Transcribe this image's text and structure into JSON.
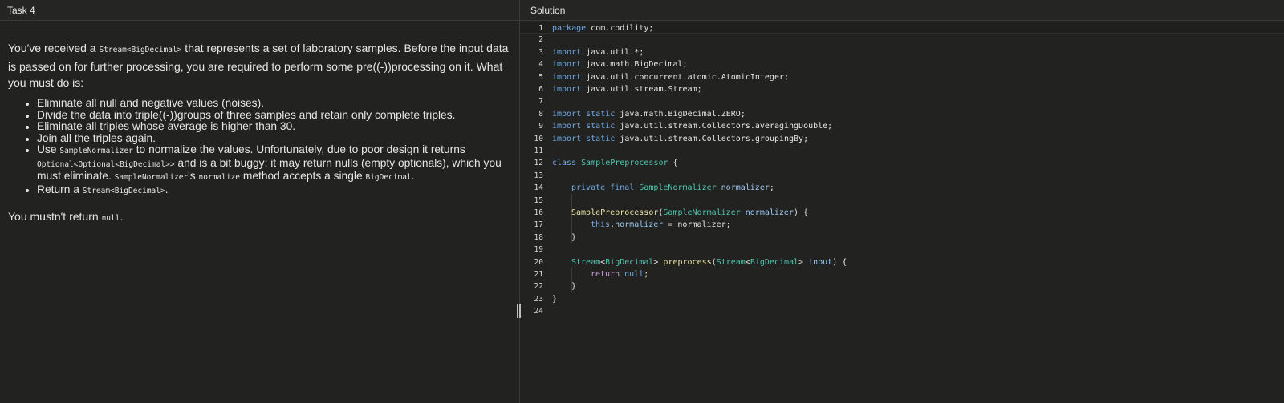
{
  "task": {
    "header": "Task 4",
    "intro_1": "You've received a ",
    "intro_code": "Stream<BigDecimal>",
    "intro_2": " that represents a set of laboratory samples. Before the input data is passed on for further processing, you are required to perform some pre((-))processing on it. What you must do is:",
    "items": {
      "i1": "Eliminate all null and negative values (noises).",
      "i2": "Divide the data into triple((-))groups of three samples and retain only complete triples.",
      "i3": "Eliminate all triples whose average is higher than 30.",
      "i4": "Join all the triples again.",
      "i5_a": "Use ",
      "i5_code1": "SampleNormalizer",
      "i5_b": " to normalize the values. Unfortunately, due to poor design it returns ",
      "i5_code2": "Optional<Optional<BigDecimal>>",
      "i5_c": " and is a bit buggy: it may return nulls (empty optionals), which you must eliminate. ",
      "i5_code3": "SampleNormalizer",
      "i5_d": "'s ",
      "i5_code4": "normalize",
      "i5_e": " method accepts a single ",
      "i5_code5": "BigDecimal",
      "i5_f": ".",
      "i6_a": "Return a ",
      "i6_code": "Stream<BigDecimal>",
      "i6_b": "."
    },
    "must_not_a": "You mustn't return ",
    "must_not_code": "null",
    "must_not_b": "."
  },
  "solution": {
    "header": "Solution",
    "line_numbers": [
      "1",
      "2",
      "3",
      "4",
      "5",
      "6",
      "7",
      "8",
      "9",
      "10",
      "11",
      "12",
      "13",
      "14",
      "15",
      "16",
      "17",
      "18",
      "19",
      "20",
      "21",
      "22",
      "23",
      "24"
    ],
    "code": {
      "l1_kw": "package",
      "l1_t": " com.codility;",
      "l3_kw": "import",
      "l3_t": " java.util.*;",
      "l4_kw": "import",
      "l4_t": " java.math.BigDecimal;",
      "l5_kw": "import",
      "l5_t": " java.util.concurrent.atomic.AtomicInteger;",
      "l6_kw": "import",
      "l6_t": " java.util.stream.Stream;",
      "l8_kw": "import static",
      "l8_t": " java.math.BigDecimal.ZERO;",
      "l9_kw": "import static",
      "l9_t": " java.util.stream.Collectors.averagingDouble;",
      "l10_kw": "import static",
      "l10_t": " java.util.stream.Collectors.groupingBy;",
      "l12_kw": "class",
      "l12_ty": " SamplePreprocessor",
      "l12_t": " {",
      "l14_kw": "private final",
      "l14_ty": " SampleNormalizer",
      "l14_fld": " normalizer",
      "l14_t": ";",
      "l16_fn": "SamplePreprocessor",
      "l16_a": "(",
      "l16_ty": "SampleNormalizer",
      "l16_fld": " normalizer",
      "l16_b": ") {",
      "l17_kw": "this",
      "l17_a": ".",
      "l17_fld": "normalizer",
      "l17_b": " = normalizer;",
      "l18_t": "}",
      "l20_ty1": "Stream",
      "l20_a": "<",
      "l20_ty2": "BigDecimal",
      "l20_b": "> ",
      "l20_fn": "preprocess",
      "l20_c": "(",
      "l20_ty3": "Stream",
      "l20_d": "<",
      "l20_ty4": "BigDecimal",
      "l20_e": ">",
      "l20_fld": " input",
      "l20_f": ") {",
      "l21_kw": "return",
      "l21_kw2": " null",
      "l21_t": ";",
      "l22_t": "}",
      "l23_t": "}"
    }
  },
  "colors": {
    "background": "#222220",
    "keyword": "#6ea9e8",
    "type": "#4fc6b0",
    "function": "#e8e2a8",
    "field": "#9bc8f3",
    "return": "#c79bd9"
  }
}
